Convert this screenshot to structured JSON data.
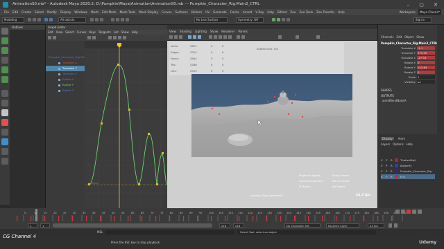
{
  "window": {
    "title": "AnimationS0.mb* - Autodesk Maya 2020.2: D:\\Pumpkin\\Maya\\Animation\\AnimationS0.mb --- Pumpkin_Character_Rig:Main2_CTRL",
    "controls": "–  ▢  ✕"
  },
  "menubar": {
    "items": [
      "File",
      "Edit",
      "Create",
      "Select",
      "Modify",
      "Display",
      "Windows",
      "Mesh",
      "Edit Mesh",
      "Mesh Tools",
      "Mesh Display",
      "Curves",
      "Surfaces",
      "Deform",
      "UV",
      "Generate",
      "Cache",
      "Arnold",
      "V-Ray",
      "Help",
      "Bifrost",
      "Zoo",
      "Zoo Tools",
      "Zoo Transfer",
      "Help"
    ],
    "workspace_label": "Workspace:",
    "workspace_value": "Maya Classic*"
  },
  "statusline": {
    "mode": "Modeling",
    "objects_label": "All objects",
    "live_surface": "No Live Surface",
    "symmetry": "Symmetry: Off",
    "sign_in": "Sign In"
  },
  "outliner": {
    "tabs": [
      "Outliner",
      "Graph Editor"
    ]
  },
  "graph_editor": {
    "menu": [
      "Edit",
      "View",
      "Select",
      "Curves",
      "Keys",
      "Tangents",
      "List",
      "Show",
      "Help"
    ],
    "curves": [
      {
        "label": "Pumpkin_Character_Rig:Main2_CTRL",
        "color": "#dcdcdc",
        "selected": false
      },
      {
        "label": "Translate X",
        "color": "#e04a4a",
        "selected": false
      },
      {
        "label": "Translate Y",
        "color": "#6cd46c",
        "selected": true
      },
      {
        "label": "Translate Z",
        "color": "#4a7ae0",
        "selected": false
      },
      {
        "label": "Rotate X",
        "color": "#e04a4a",
        "selected": false
      },
      {
        "label": "Rotate Y",
        "color": "#6cd46c",
        "selected": false
      },
      {
        "label": "Rotate Z",
        "color": "#4a7ae0",
        "selected": false
      }
    ],
    "current_frame_marker": "15"
  },
  "viewport": {
    "menu": [
      "View",
      "Shading",
      "Lighting",
      "Show",
      "Renderer",
      "Panels"
    ],
    "hud_rows": [
      {
        "name": "Verts:",
        "a": "2671",
        "b": "0",
        "c": "0"
      },
      {
        "name": "Edges:",
        "a": "5314",
        "b": "0",
        "c": "0"
      },
      {
        "name": "Faces:",
        "a": "2644",
        "b": "0",
        "c": "0"
      },
      {
        "name": "Tris:",
        "a": "5288",
        "b": "0",
        "c": "0"
      },
      {
        "name": "UVs:",
        "a": "2913",
        "b": "0",
        "c": "0"
      }
    ],
    "hud_extra": "Subdiv Divs: 0/4",
    "playback_speed_label": "Playback Speed:",
    "playback_speed_value": "Every Frame",
    "current_character_label": "Current Character:",
    "current_character_value": "No Character",
    "ik_blend_label": "IK Blend:",
    "ik_blend_value": "No Solver",
    "camera": "camera_PhysCamera002",
    "fps": "24.2 fps"
  },
  "channel_box": {
    "tabs": [
      "Channels",
      "Edit",
      "Object",
      "Show"
    ],
    "object_name": "Pumpkin_Character_Rig:Main2_CTRL",
    "channels": [
      {
        "label": "Translate X",
        "value": "-1.1",
        "keyed": true
      },
      {
        "label": "Translate Y",
        "value": "175.09",
        "keyed": true
      },
      {
        "label": "Translate Z",
        "value": "-27.94",
        "keyed": true
      },
      {
        "label": "Rotate X",
        "value": "0",
        "keyed": true
      },
      {
        "label": "Rotate Y",
        "value": "142.84",
        "keyed": true
      },
      {
        "label": "Rotate Z",
        "value": "0",
        "keyed": true
      },
      {
        "label": "Scale",
        "value": "1",
        "keyed": false
      },
      {
        "label": "Visibility",
        "value": "on",
        "keyed": false
      }
    ],
    "shapes_label": "SHAPES",
    "outputs_label": "OUTPUTS",
    "output_item": "animBlendNodeA"
  },
  "layer_editor": {
    "tabs": [
      "Display",
      "Anim"
    ],
    "menu": [
      "Layers",
      "Options",
      "Help"
    ],
    "layers": [
      {
        "v": "V",
        "p": "P",
        "r": "R",
        "name": "TheLastBall"
      },
      {
        "v": "V",
        "p": "P",
        "r": "R",
        "name": "Butterfly"
      },
      {
        "v": "V",
        "p": "P",
        "r": "R",
        "name": "Pumpkin_Character_Rig"
      },
      {
        "v": "V",
        "p": "P",
        "r": "R",
        "name": "Env"
      }
    ]
  },
  "timeslider": {
    "start": 0,
    "end": 200,
    "ticks": [
      "5",
      "10",
      "15",
      "20",
      "25",
      "30",
      "35",
      "40",
      "45",
      "50",
      "55",
      "60",
      "65",
      "70",
      "75",
      "80",
      "85",
      "90",
      "95",
      "100",
      "105",
      "110",
      "115",
      "120",
      "125",
      "130",
      "135",
      "140",
      "145",
      "150",
      "155",
      "160",
      "165",
      "170",
      "175",
      "180",
      "185",
      "190",
      "195",
      "200"
    ],
    "current_frame": "15"
  },
  "range_bar": {
    "start": "1",
    "range_start": "1",
    "range_end": "216",
    "end": "216",
    "no_character": "No Character Set",
    "no_anim_layer": "No Anim Layer",
    "fps": "24 fps"
  },
  "cmdline": {
    "label": "MEL",
    "result": "Select Tool: select an object"
  },
  "helpline": {
    "text": "Press the ESC key to stop playback"
  },
  "watermark": "CG Channel 4",
  "brand": "Udemy"
}
